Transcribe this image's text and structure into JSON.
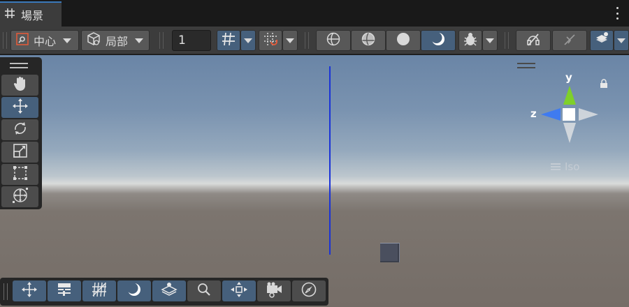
{
  "window": {
    "tab_title": "場景",
    "tab_icon": "scene-grid-icon",
    "menu_icon": "kebab-menu-icon"
  },
  "toolbar": {
    "pivot_label": "中心",
    "pivot_icon": "pivot-center-icon",
    "space_label": "局部",
    "space_icon": "local-space-cube-icon",
    "grid_snap_value": "1",
    "buttons": [
      "grid-visibility-icon",
      "grid-snap-icon",
      "wireframe-shading-icon",
      "shaded-wireframe-icon",
      "shaded-icon",
      "lighting-icon",
      "debug-bug-icon",
      "audio-off-icon",
      "effects-off-icon",
      "draw-modes-icon"
    ]
  },
  "tools_overlay": {
    "items": [
      "hand-tool-icon",
      "move-tool-icon",
      "rotate-tool-icon",
      "scale-tool-icon",
      "rect-tool-icon",
      "transform-tool-icon"
    ],
    "active": "move-tool-icon"
  },
  "bottom_overlay": {
    "items": [
      "move-tool-icon",
      "sliders-icon",
      "grid-lines-icon",
      "moon-icon",
      "layers-icon",
      "search-icon",
      "snap-center-icon",
      "camera-icon",
      "compass-icon"
    ]
  },
  "gizmo": {
    "y_label": "y",
    "z_label": "z",
    "projection_label": "Iso",
    "colors": {
      "y": "#7fd02a",
      "z": "#3f7bf0",
      "neutral": "#e8e8e8"
    }
  },
  "colors": {
    "accent": "#3a79bb",
    "active_button": "#46607c",
    "toolbar_bg": "#3c3c3c",
    "overlay_bg": "#262626",
    "axis_line": "#1a33d8"
  }
}
